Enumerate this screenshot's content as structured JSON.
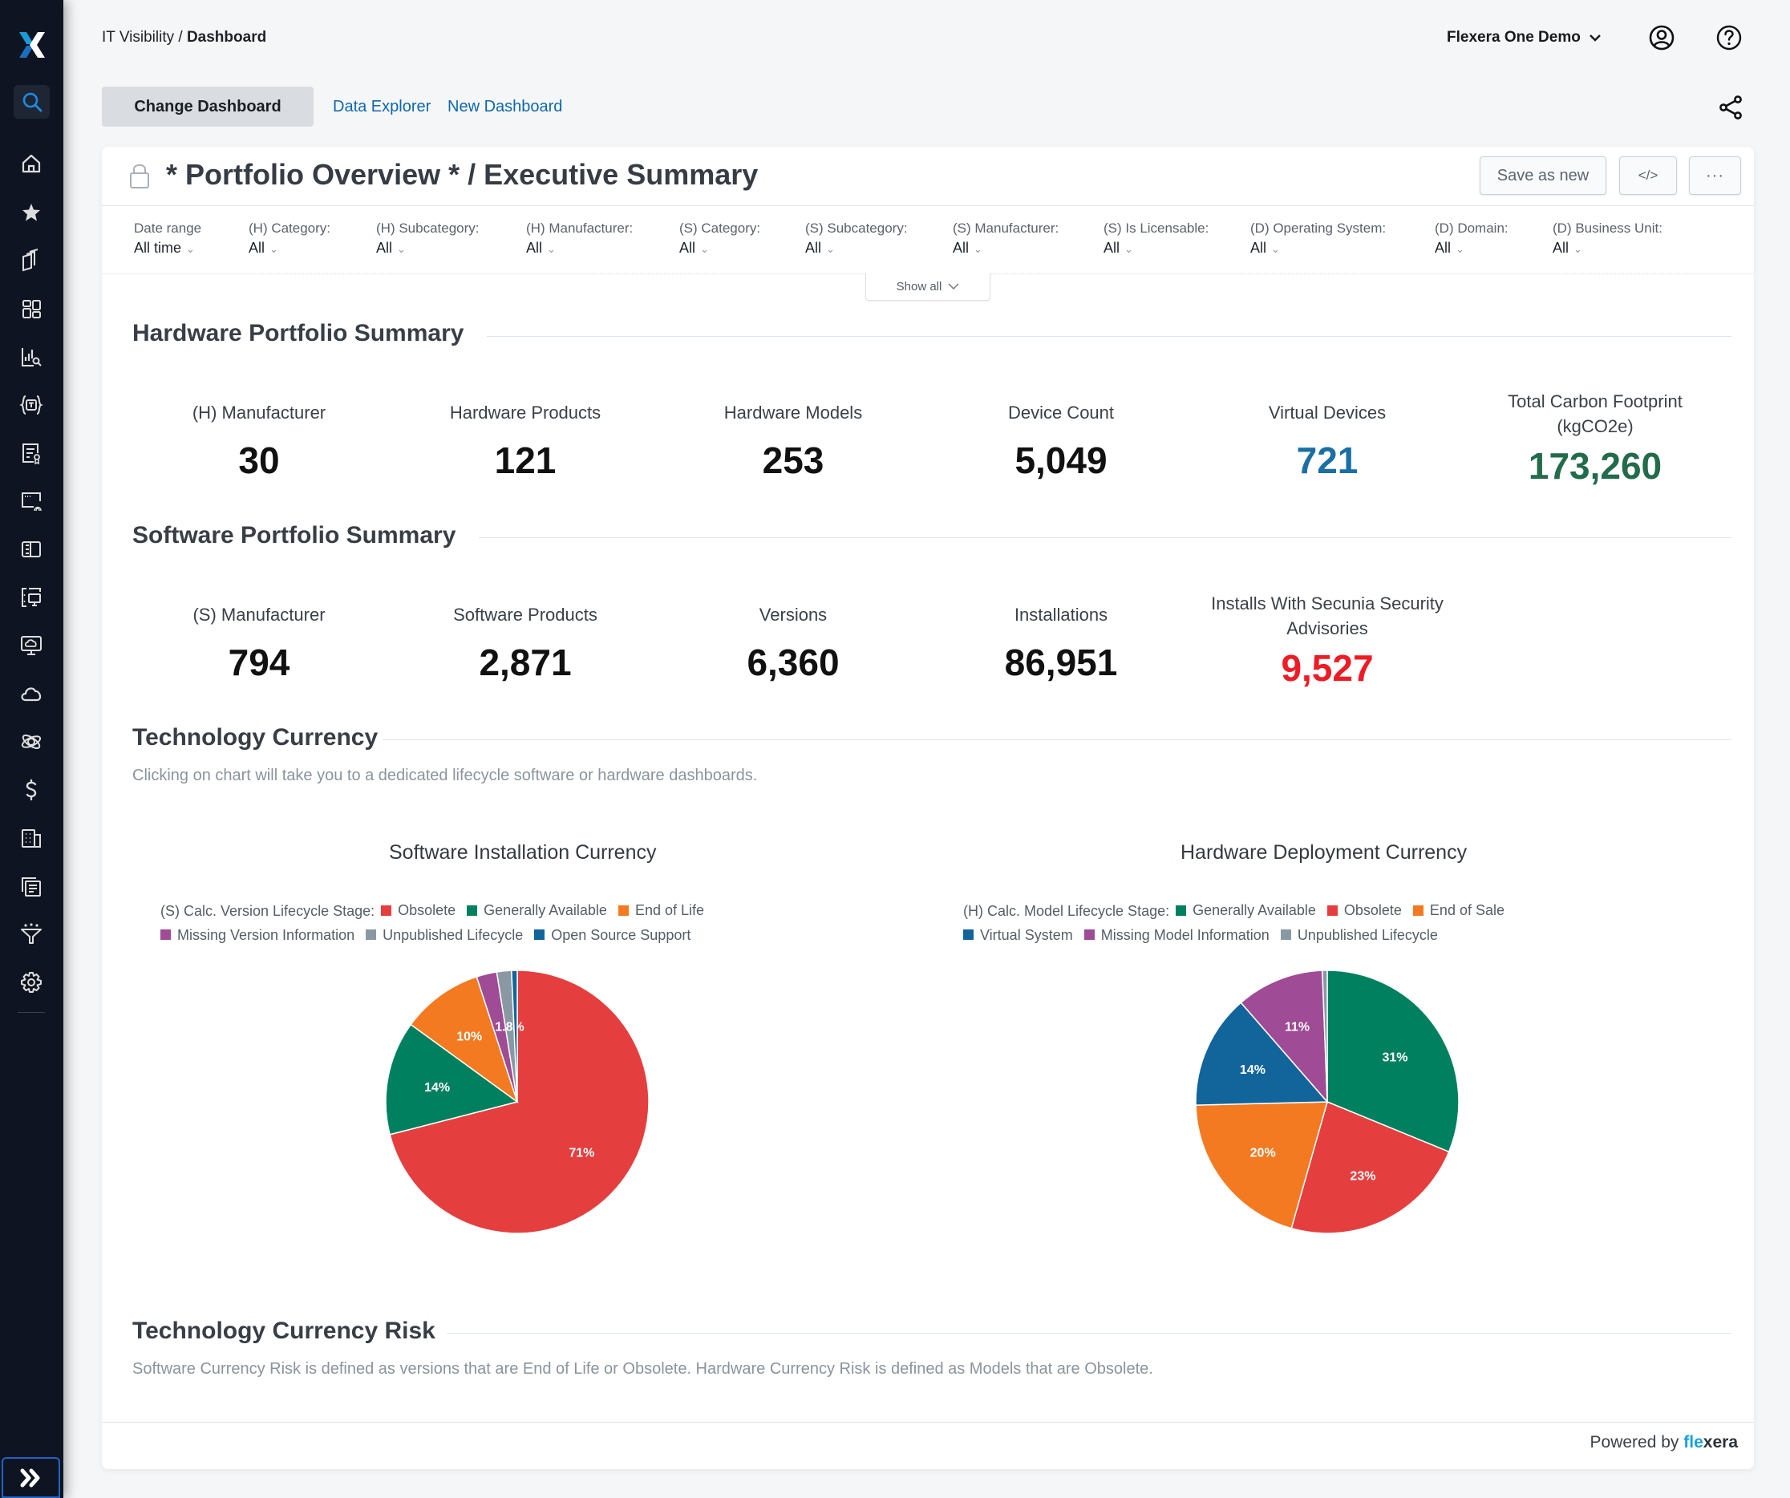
{
  "breadcrumb": {
    "parent": "IT Visibility",
    "separator": " / ",
    "current": "Dashboard"
  },
  "org": {
    "name": "Flexera One Demo"
  },
  "icons": {
    "user": "user-circle-icon",
    "help": "help-circle-icon",
    "share": "share-icon",
    "lock": "lock-icon"
  },
  "toolbar": {
    "change_dashboard": "Change Dashboard",
    "data_explorer": "Data Explorer",
    "new_dashboard": "New Dashboard"
  },
  "sidebar": {
    "items": [
      {
        "name": "search",
        "active": true
      },
      {
        "name": "home"
      },
      {
        "name": "favorites"
      },
      {
        "name": "inventory"
      },
      {
        "name": "dashboards"
      },
      {
        "name": "analytics"
      },
      {
        "name": "technopedia"
      },
      {
        "name": "licenses"
      },
      {
        "name": "secure-apps"
      },
      {
        "name": "contracts"
      },
      {
        "name": "devices"
      },
      {
        "name": "cloud-desktops"
      },
      {
        "name": "cloud"
      },
      {
        "name": "integrations"
      },
      {
        "name": "cost"
      },
      {
        "name": "organization"
      },
      {
        "name": "reports"
      },
      {
        "name": "data-processing"
      },
      {
        "name": "settings"
      }
    ],
    "expand_label": "»"
  },
  "dashboard": {
    "title": "* Portfolio Overview * / Executive Summary",
    "save_as_new": "Save as new",
    "embed_label": "</>",
    "more_label": "···",
    "show_all": "Show all",
    "filters": [
      {
        "label": "Date range",
        "value": "All time"
      },
      {
        "label": "(H) Category:",
        "value": "All"
      },
      {
        "label": "(H) Subcategory:",
        "value": "All"
      },
      {
        "label": "(H) Manufacturer:",
        "value": "All"
      },
      {
        "label": "(S) Category:",
        "value": "All"
      },
      {
        "label": "(S) Subcategory:",
        "value": "All"
      },
      {
        "label": "(S) Manufacturer:",
        "value": "All"
      },
      {
        "label": "(S) Is Licensable:",
        "value": "All"
      },
      {
        "label": "(D) Operating System:",
        "value": "All"
      },
      {
        "label": "(D) Domain:",
        "value": "All"
      },
      {
        "label": "(D) Business Unit:",
        "value": "All"
      }
    ]
  },
  "hardware": {
    "title": "Hardware Portfolio Summary",
    "kpis": [
      {
        "label": "(H) Manufacturer",
        "value": "30",
        "color": "#111111"
      },
      {
        "label": "Hardware Products",
        "value": "121",
        "color": "#111111"
      },
      {
        "label": "Hardware Models",
        "value": "253",
        "color": "#111111"
      },
      {
        "label": "Device Count",
        "value": "5,049",
        "color": "#111111"
      },
      {
        "label": "Virtual Devices",
        "value": "721",
        "color": "#1a6fa3"
      },
      {
        "label": "Total Carbon Footprint (kgCO2e)",
        "value": "173,260",
        "color": "#226b4b"
      }
    ]
  },
  "software": {
    "title": "Software Portfolio Summary",
    "kpis": [
      {
        "label": "(S) Manufacturer",
        "value": "794",
        "color": "#111111"
      },
      {
        "label": "Software Products",
        "value": "2,871",
        "color": "#111111"
      },
      {
        "label": "Versions",
        "value": "6,360",
        "color": "#111111"
      },
      {
        "label": "Installations",
        "value": "86,951",
        "color": "#111111"
      },
      {
        "label": "Installs With Secunia Security Advisories",
        "value": "9,527",
        "color": "#ee1c25"
      }
    ]
  },
  "currency": {
    "title": "Technology Currency",
    "description": "Clicking on chart will take you to a dedicated lifecycle software or hardware dashboards."
  },
  "risk": {
    "title": "Technology Currency Risk",
    "description": "Software Currency Risk is defined as versions that are End of Life or Obsolete.  Hardware Currency Risk is defined as Models that are Obsolete."
  },
  "footer": {
    "powered_by": "Powered by",
    "brand_a": "fle",
    "brand_x": "x",
    "brand_b": "era"
  },
  "chart_data": [
    {
      "type": "pie",
      "title": "Software Installation Currency",
      "legend_title": "(S) Calc. Version Lifecycle Stage:",
      "legend_placement": "top",
      "start": "12 o'clock, clockwise",
      "categories": [
        "Obsolete",
        "Generally Available",
        "End of Life",
        "Missing Version Information",
        "Unpublished Lifecycle",
        "Open Source Support"
      ],
      "values": [
        71,
        14,
        10,
        2.5,
        1.8,
        0.7
      ],
      "labels": [
        "71%",
        "14%",
        "10%",
        "",
        "1.8%",
        ""
      ],
      "colors": [
        "#e53e3e",
        "#00805e",
        "#f37a21",
        "#a04b95",
        "#8a98a4",
        "#12659b"
      ],
      "units": "percent"
    },
    {
      "type": "pie",
      "title": "Hardware Deployment Currency",
      "legend_title": "(H) Calc. Model Lifecycle Stage:",
      "legend_placement": "top",
      "start": "12 o'clock, clockwise",
      "categories": [
        "Generally Available",
        "Obsolete",
        "End of Sale",
        "Virtual System",
        "Missing Model Information",
        "Unpublished Lifecycle"
      ],
      "values": [
        31.2,
        23.2,
        20.2,
        14,
        10.8,
        0.6
      ],
      "labels": [
        "31%",
        "23%",
        "20%",
        "14%",
        "11%",
        ""
      ],
      "colors": [
        "#00805e",
        "#e53e3e",
        "#f37a21",
        "#12659b",
        "#a04b95",
        "#8a98a4"
      ],
      "units": "percent"
    }
  ]
}
